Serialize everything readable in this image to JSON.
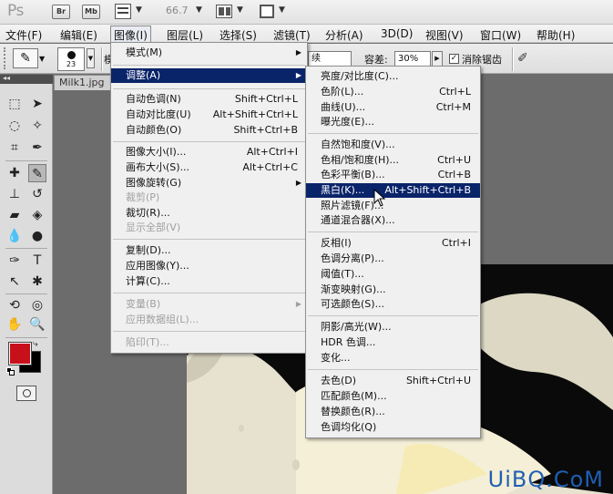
{
  "app": {
    "logo": "Ps",
    "buttons": [
      "Br",
      "Mb"
    ],
    "zoom": "66.7"
  },
  "menubar": [
    {
      "label": "文件(F)",
      "active": false
    },
    {
      "label": "编辑(E)",
      "active": false
    },
    {
      "label": "图像(I)",
      "active": true
    },
    {
      "label": "图层(L)",
      "active": false
    },
    {
      "label": "选择(S)",
      "active": false
    },
    {
      "label": "滤镜(T)",
      "active": false
    },
    {
      "label": "分析(A)",
      "active": false
    },
    {
      "label": "3D(D)",
      "active": false
    },
    {
      "label": "视图(V)",
      "active": false
    },
    {
      "label": "窗口(W)",
      "active": false
    },
    {
      "label": "帮助(H)",
      "active": false
    }
  ],
  "options": {
    "brush_size": "23",
    "mode_label_partial": "模",
    "mode_value_partial": "续",
    "tolerance_label": "容差:",
    "tolerance_value": "30%",
    "antialias_label": "消除锯齿",
    "antialias_checked": "✓"
  },
  "document": {
    "tab_label": "Milk1.jpg"
  },
  "image_menu": [
    {
      "label": "模式(M)",
      "shortcut": "",
      "submenu": true,
      "disabled": false,
      "sep_after": false
    },
    {
      "label": "调整(A)",
      "shortcut": "",
      "submenu": true,
      "disabled": false,
      "highlight": true,
      "sep_after": true
    },
    {
      "label": "自动色调(N)",
      "shortcut": "Shift+Ctrl+L",
      "disabled": false
    },
    {
      "label": "自动对比度(U)",
      "shortcut": "Alt+Shift+Ctrl+L",
      "disabled": false
    },
    {
      "label": "自动颜色(O)",
      "shortcut": "Shift+Ctrl+B",
      "disabled": false,
      "sep_after": true
    },
    {
      "label": "图像大小(I)...",
      "shortcut": "Alt+Ctrl+I",
      "disabled": false
    },
    {
      "label": "画布大小(S)...",
      "shortcut": "Alt+Ctrl+C",
      "disabled": false
    },
    {
      "label": "图像旋转(G)",
      "shortcut": "",
      "submenu": true,
      "disabled": false
    },
    {
      "label": "裁剪(P)",
      "shortcut": "",
      "disabled": true
    },
    {
      "label": "裁切(R)...",
      "shortcut": "",
      "disabled": false
    },
    {
      "label": "显示全部(V)",
      "shortcut": "",
      "disabled": true,
      "sep_after": true
    },
    {
      "label": "复制(D)...",
      "shortcut": "",
      "disabled": false
    },
    {
      "label": "应用图像(Y)...",
      "shortcut": "",
      "disabled": false
    },
    {
      "label": "计算(C)...",
      "shortcut": "",
      "disabled": false,
      "sep_after": true
    },
    {
      "label": "变量(B)",
      "shortcut": "",
      "submenu": true,
      "disabled": true
    },
    {
      "label": "应用数据组(L)...",
      "shortcut": "",
      "disabled": true,
      "sep_after": true
    },
    {
      "label": "陷印(T)...",
      "shortcut": "",
      "disabled": true
    }
  ],
  "adjust_menu": [
    {
      "label": "亮度/对比度(C)...",
      "shortcut": ""
    },
    {
      "label": "色阶(L)...",
      "shortcut": "Ctrl+L"
    },
    {
      "label": "曲线(U)...",
      "shortcut": "Ctrl+M"
    },
    {
      "label": "曝光度(E)...",
      "shortcut": "",
      "sep_after": true
    },
    {
      "label": "自然饱和度(V)...",
      "shortcut": ""
    },
    {
      "label": "色相/饱和度(H)...",
      "shortcut": "Ctrl+U"
    },
    {
      "label": "色彩平衡(B)...",
      "shortcut": "Ctrl+B"
    },
    {
      "label": "黑白(K)...",
      "shortcut": "Alt+Shift+Ctrl+B",
      "highlight": true
    },
    {
      "label": "照片滤镜(F)...",
      "shortcut": ""
    },
    {
      "label": "通道混合器(X)...",
      "shortcut": "",
      "sep_after": true
    },
    {
      "label": "反相(I)",
      "shortcut": "Ctrl+I"
    },
    {
      "label": "色调分离(P)...",
      "shortcut": ""
    },
    {
      "label": "阈值(T)...",
      "shortcut": ""
    },
    {
      "label": "渐变映射(G)...",
      "shortcut": ""
    },
    {
      "label": "可选颜色(S)...",
      "shortcut": "",
      "sep_after": true
    },
    {
      "label": "阴影/高光(W)...",
      "shortcut": ""
    },
    {
      "label": "HDR 色调...",
      "shortcut": ""
    },
    {
      "label": "变化...",
      "shortcut": "",
      "sep_after": true
    },
    {
      "label": "去色(D)",
      "shortcut": "Shift+Ctrl+U"
    },
    {
      "label": "匹配颜色(M)...",
      "shortcut": ""
    },
    {
      "label": "替换颜色(R)...",
      "shortcut": ""
    },
    {
      "label": "色调均化(Q)",
      "shortcut": ""
    }
  ],
  "colors": {
    "foreground": "#c8101a",
    "background": "#000000",
    "highlight": "#0a246a"
  },
  "watermark": "UiBQ.CoM"
}
